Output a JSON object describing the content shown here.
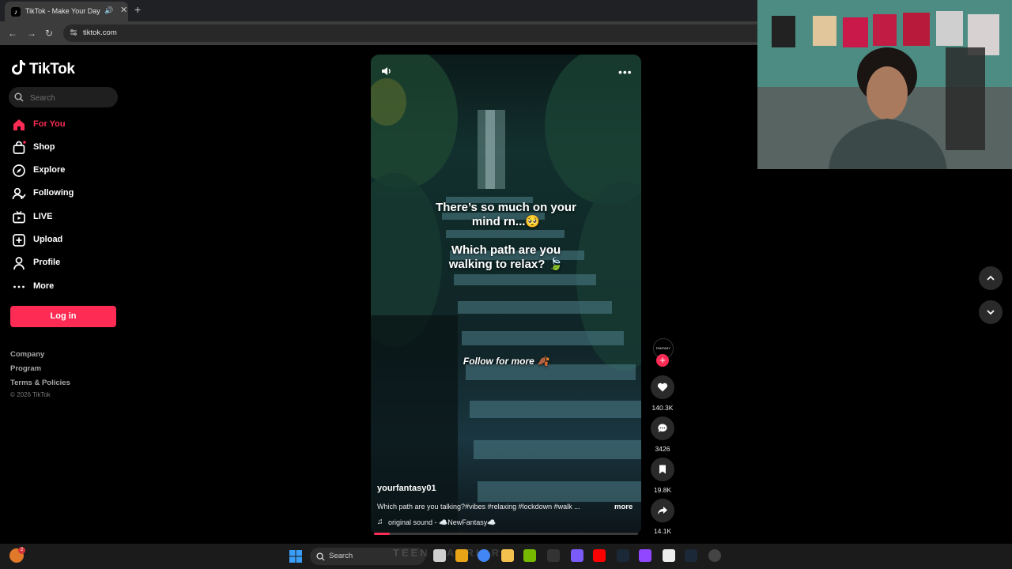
{
  "browser": {
    "tab_title": "TikTok - Make Your Day",
    "url": "tiktok.com"
  },
  "sidebar": {
    "logo_text": "TikTok",
    "search_placeholder": "Search",
    "nav": [
      {
        "label": "For You",
        "icon": "home-icon",
        "active": true
      },
      {
        "label": "Shop",
        "icon": "shop-icon"
      },
      {
        "label": "Explore",
        "icon": "compass-icon"
      },
      {
        "label": "Following",
        "icon": "following-icon"
      },
      {
        "label": "LIVE",
        "icon": "live-icon"
      },
      {
        "label": "Upload",
        "icon": "upload-icon"
      },
      {
        "label": "Profile",
        "icon": "profile-icon"
      },
      {
        "label": "More",
        "icon": "more-icon"
      }
    ],
    "login_label": "Log in",
    "footer_links": [
      "Company",
      "Program",
      "Terms & Policies"
    ],
    "copyright": "© 2026 TikTok"
  },
  "video": {
    "caption_line1": "There’s so much on your",
    "caption_line2": "mind rn...🥺",
    "caption_line3": "Which path are you",
    "caption_line4": "walking to relax? 🍃",
    "follow_caption": "Follow for more 🍂",
    "author": "yourfantasy01",
    "description": "Which path are you talking?#vibes #relaxing #lockdown #walk ...",
    "more_label": "more",
    "sound": "original sound - ☁️NewFantasy☁️",
    "progress": 0.06
  },
  "actions": {
    "avatar_text": "FANTASY",
    "likes": "140.3K",
    "comments": "3426",
    "saves": "19.8K",
    "shares": "14.1K"
  },
  "taskbar": {
    "search_label": "Search",
    "overlay_text": "TEEN WARRIORS",
    "badge_count": "2"
  },
  "colors": {
    "accent": "#fe2c55",
    "background": "#000000"
  }
}
